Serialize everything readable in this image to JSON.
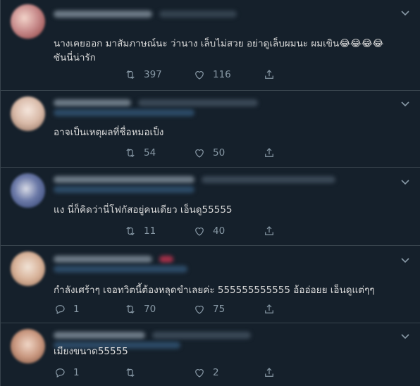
{
  "tweets": [
    {
      "text_line1": "นางเคยออก มาสัมภาษณ์นะ ว่านาง เล็บไม่สวย อย่าดูเล็บผมนะ ผมเขิน😂😂😂😂",
      "text_line2": "ซันนี่น่ารัก",
      "reply_count": "",
      "retweet_count": "397",
      "like_count": "116"
    },
    {
      "text_line1": "อาจเป็นเหตุผลที่ชื่อหมอเป็ง",
      "reply_count": "",
      "retweet_count": "54",
      "like_count": "50"
    },
    {
      "text_line1": "แง นี่ก็คิดว่านี่โฟกัสอยู่คนเดียว เอ็นดู55555",
      "reply_count": "",
      "retweet_count": "11",
      "like_count": "40"
    },
    {
      "text_line1": "กำลังเศร้าๆ เจอทวิตนี้ต้องหลุดขำเลยค่ะ 555555555555 อ้ออ่อยย เอ็นดูแต่ๆๆ",
      "reply_count": "1",
      "retweet_count": "70",
      "like_count": "75"
    },
    {
      "text_line1": "เมียงขนาด55555",
      "reply_count": "1",
      "retweet_count": "",
      "like_count": "2"
    }
  ],
  "colors": {
    "background": "#15202b",
    "border": "#38444d",
    "text": "#d9d9d9",
    "muted": "#8899a6"
  },
  "icons": [
    "chevron-down-icon",
    "reply-icon",
    "retweet-icon",
    "like-icon",
    "share-icon"
  ]
}
